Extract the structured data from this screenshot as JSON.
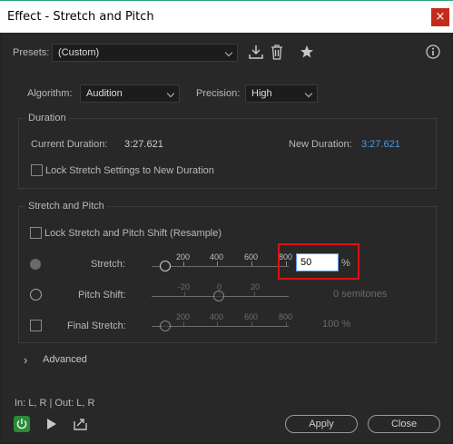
{
  "window": {
    "title": "Effect - Stretch and Pitch",
    "close_glyph": "×"
  },
  "presets": {
    "label": "Presets:",
    "value": "(Custom)"
  },
  "settings": {
    "algorithm_label": "Algorithm:",
    "algorithm_value": "Audition",
    "precision_label": "Precision:",
    "precision_value": "High"
  },
  "duration": {
    "group_title": "Duration",
    "current_label": "Current Duration:",
    "current_value": "3:27.621",
    "new_label": "New Duration:",
    "new_value": "3:27.621",
    "lock_label": "Lock Stretch Settings to New Duration"
  },
  "stretch_pitch": {
    "group_title": "Stretch and Pitch",
    "lock_label": "Lock Stretch and Pitch Shift (Resample)",
    "stretch": {
      "label": "Stretch:",
      "ticks": [
        "200",
        "400",
        "600",
        "800"
      ],
      "value": "50",
      "unit": "%"
    },
    "pitch": {
      "label": "Pitch Shift:",
      "ticks": [
        "-20",
        "0",
        "20"
      ],
      "readout": "0 semitones"
    },
    "final": {
      "label": "Final Stretch:",
      "ticks": [
        "200",
        "400",
        "600",
        "800"
      ],
      "readout": "100 %"
    }
  },
  "advanced": {
    "label": "Advanced",
    "chevron": "›"
  },
  "io": {
    "label": "In: L, R | Out: L, R"
  },
  "buttons": {
    "apply": "Apply",
    "close": "Close"
  },
  "colors": {
    "accent_blue": "#4a98e8",
    "power_green": "#2c8b3a",
    "highlight_red": "#e01010"
  }
}
